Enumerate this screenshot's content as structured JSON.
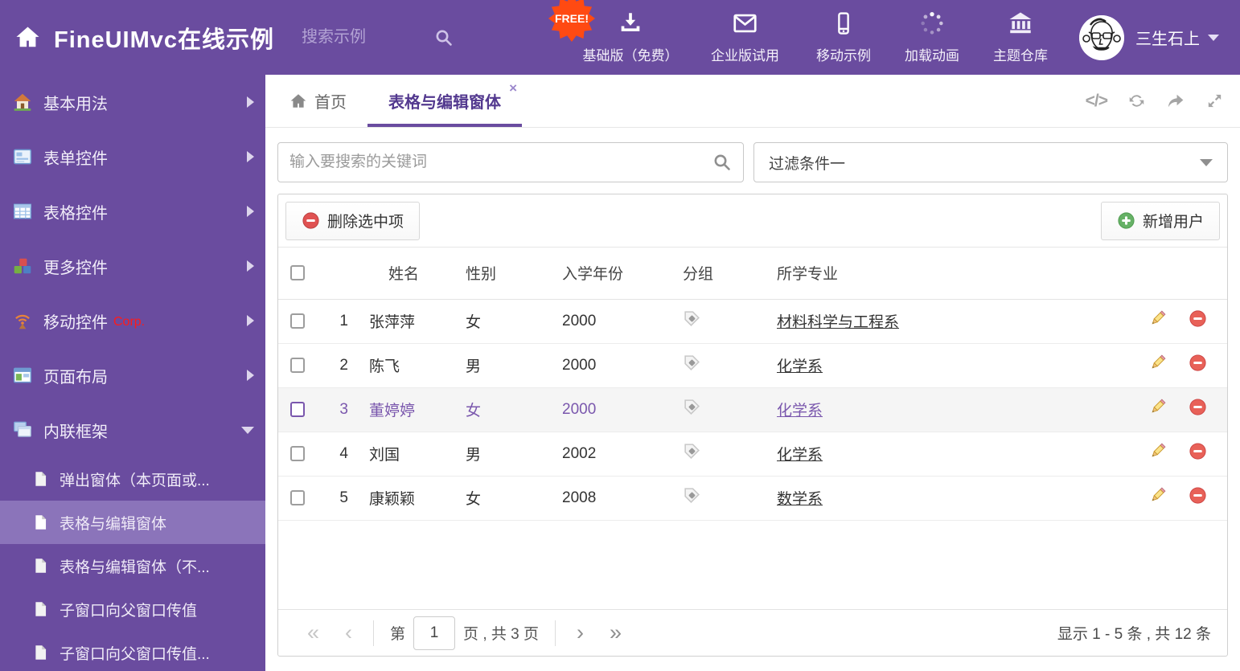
{
  "colors": {
    "theme_purple": "#6a4c9f",
    "sidebar_selected": "#8b74ba",
    "free_badge_orange": "#ff4a12",
    "selected_row_text": "#7a57ad",
    "tag_blue": "#85c4f0",
    "tag_green": "#8bc34a",
    "tag_orange": "#ffb266",
    "delete_red": "#e05252",
    "add_green": "#66b166"
  },
  "header": {
    "title": "FineUIMvc在线示例",
    "search_placeholder": "搜索示例",
    "free_badge": "FREE!",
    "nav": [
      {
        "label": "基础版（免费）",
        "icon": "download-icon"
      },
      {
        "label": "企业版试用",
        "icon": "envelope-icon"
      },
      {
        "label": "移动示例",
        "icon": "mobile-icon"
      },
      {
        "label": "加载动画",
        "icon": "spinner-icon"
      },
      {
        "label": "主题仓库",
        "icon": "bank-icon"
      }
    ],
    "username": "三生石上"
  },
  "sidebar": {
    "items": [
      {
        "label": "基本用法"
      },
      {
        "label": "表单控件"
      },
      {
        "label": "表格控件"
      },
      {
        "label": "更多控件"
      },
      {
        "label": "移动控件",
        "badge": "Corp."
      },
      {
        "label": "页面布局"
      },
      {
        "label": "内联框架"
      }
    ],
    "subitems": [
      {
        "label": "弹出窗体（本页面或..."
      },
      {
        "label": "表格与编辑窗体",
        "selected": true
      },
      {
        "label": "表格与编辑窗体（不..."
      },
      {
        "label": "子窗口向父窗口传值"
      },
      {
        "label": "子窗口向父窗口传值..."
      }
    ]
  },
  "tabs": {
    "home": "首页",
    "active": "表格与编辑窗体"
  },
  "search": {
    "placeholder": "输入要搜索的关键词"
  },
  "filter": {
    "value": "过滤条件一"
  },
  "grid": {
    "delete_button": "删除选中项",
    "add_button": "新增用户",
    "columns": {
      "name": "姓名",
      "gender": "性别",
      "year": "入学年份",
      "group": "分组",
      "major": "所学专业"
    },
    "rows": [
      {
        "num": "1",
        "name": "张萍萍",
        "gender": "女",
        "year": "2000",
        "tag": "blue",
        "major": "材料科学与工程系",
        "selected": false
      },
      {
        "num": "2",
        "name": "陈飞",
        "gender": "男",
        "year": "2000",
        "tag": "blue",
        "major": "化学系",
        "selected": false
      },
      {
        "num": "3",
        "name": "董婷婷",
        "gender": "女",
        "year": "2000",
        "tag": "green",
        "major": "化学系",
        "selected": true
      },
      {
        "num": "4",
        "name": "刘国",
        "gender": "男",
        "year": "2002",
        "tag": "green",
        "major": "化学系",
        "selected": false
      },
      {
        "num": "5",
        "name": "康颖颖",
        "gender": "女",
        "year": "2008",
        "tag": "orange",
        "major": "数学系",
        "selected": false
      }
    ],
    "pagination": {
      "prefix": "第",
      "page": "1",
      "suffix": "页 , 共 3 页",
      "summary": "显示 1 - 5 条 , 共 12 条"
    }
  }
}
